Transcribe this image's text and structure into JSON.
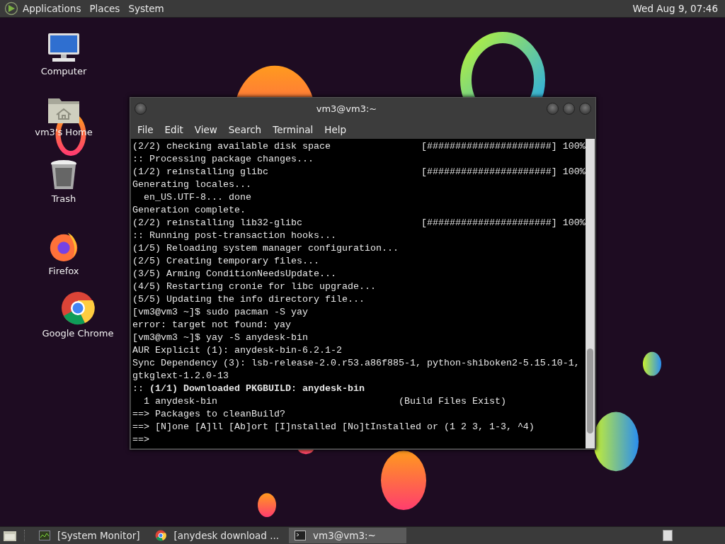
{
  "top_panel": {
    "menus": [
      "Applications",
      "Places",
      "System"
    ],
    "clock": "Wed Aug  9, 07:46"
  },
  "desktop_icons": [
    {
      "label": "Computer",
      "kind": "computer"
    },
    {
      "label": "vm3's Home",
      "kind": "home"
    },
    {
      "label": "Trash",
      "kind": "trash"
    },
    {
      "label": "Firefox",
      "kind": "firefox"
    },
    {
      "label": "Google Chrome",
      "kind": "chrome"
    }
  ],
  "terminal": {
    "title": "vm3@vm3:~",
    "menu": [
      "File",
      "Edit",
      "View",
      "Search",
      "Terminal",
      "Help"
    ],
    "lines": [
      "(2/2) checking available disk space                [######################] 100%",
      ":: Processing package changes...",
      "(1/2) reinstalling glibc                           [######################] 100%",
      "Generating locales...",
      "  en_US.UTF-8... done",
      "Generation complete.",
      "(2/2) reinstalling lib32-glibc                     [######################] 100%",
      ":: Running post-transaction hooks...",
      "(1/5) Reloading system manager configuration...",
      "(2/5) Creating temporary files...",
      "(3/5) Arming ConditionNeedsUpdate...",
      "(4/5) Restarting cronie for libc upgrade...",
      "(5/5) Updating the info directory file...",
      "[vm3@vm3 ~]$ sudo pacman -S yay",
      "error: target not found: yay",
      "[vm3@vm3 ~]$ yay -S anydesk-bin",
      "AUR Explicit (1): anydesk-bin-6.2.1-2",
      "Sync Dependency (3): lsb-release-2.0.r53.a86f885-1, python-shiboken2-5.15.10-1,",
      "gtkglext-1.2.0-13",
      ":: **(1/1) Downloaded PKGBUILD: anydesk-bin**",
      "  1 anydesk-bin                                (Build Files Exist)",
      "==> Packages to cleanBuild?",
      "==> [N]one [A]ll [Ab]ort [I]nstalled [No]tInstalled or (1 2 3, 1-3, ^4)",
      "==>"
    ]
  },
  "taskbar": {
    "tasks": [
      {
        "label": "[System Monitor]",
        "kind": "monitor",
        "selected": false
      },
      {
        "label": "[anydesk download ...",
        "kind": "chrome",
        "selected": false
      },
      {
        "label": "vm3@vm3:~",
        "kind": "terminal",
        "selected": true
      }
    ]
  }
}
